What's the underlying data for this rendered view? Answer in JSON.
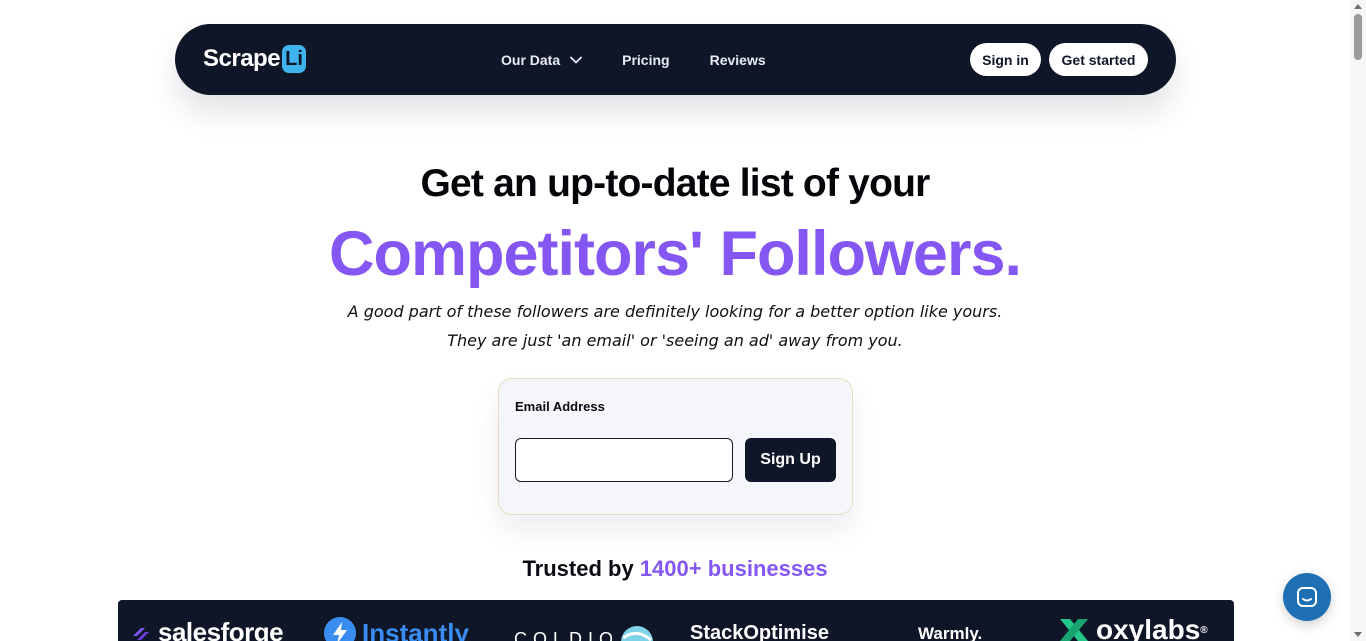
{
  "nav": {
    "logo_text": "Scrape",
    "logo_badge": "Li",
    "links": [
      {
        "label": "Our Data",
        "has_dropdown": true
      },
      {
        "label": "Pricing"
      },
      {
        "label": "Reviews"
      }
    ],
    "signin_label": "Sign in",
    "getstarted_label": "Get started"
  },
  "hero": {
    "line1": "Get an up-to-date list of your",
    "line2": "Competitors' Followers.",
    "sub1": "A good part of these followers are definitely looking for a better option like yours.",
    "sub2": "They are just 'an email' or 'seeing an ad' away from you."
  },
  "signup": {
    "label": "Email Address",
    "input_value": "",
    "button_label": "Sign Up"
  },
  "trusted": {
    "prefix": "Trusted by",
    "highlight": "1400+ businesses"
  },
  "brands": [
    {
      "name": "salesforge",
      "icon": "salesforge-icon"
    },
    {
      "name": "Instantly",
      "icon": "lightning-icon"
    },
    {
      "name": "COLDIQ",
      "icon": "coldiq-icon"
    },
    {
      "name": "StackOptimise"
    },
    {
      "name": "Warmly."
    },
    {
      "name": "oxylabs",
      "icon": "oxylabs-icon",
      "mark": "®"
    }
  ],
  "colors": {
    "navy": "#0e1628",
    "accent_purple": "#8456f2",
    "badge_blue": "#3fb4ec",
    "chat_blue": "#1f6fb5"
  }
}
